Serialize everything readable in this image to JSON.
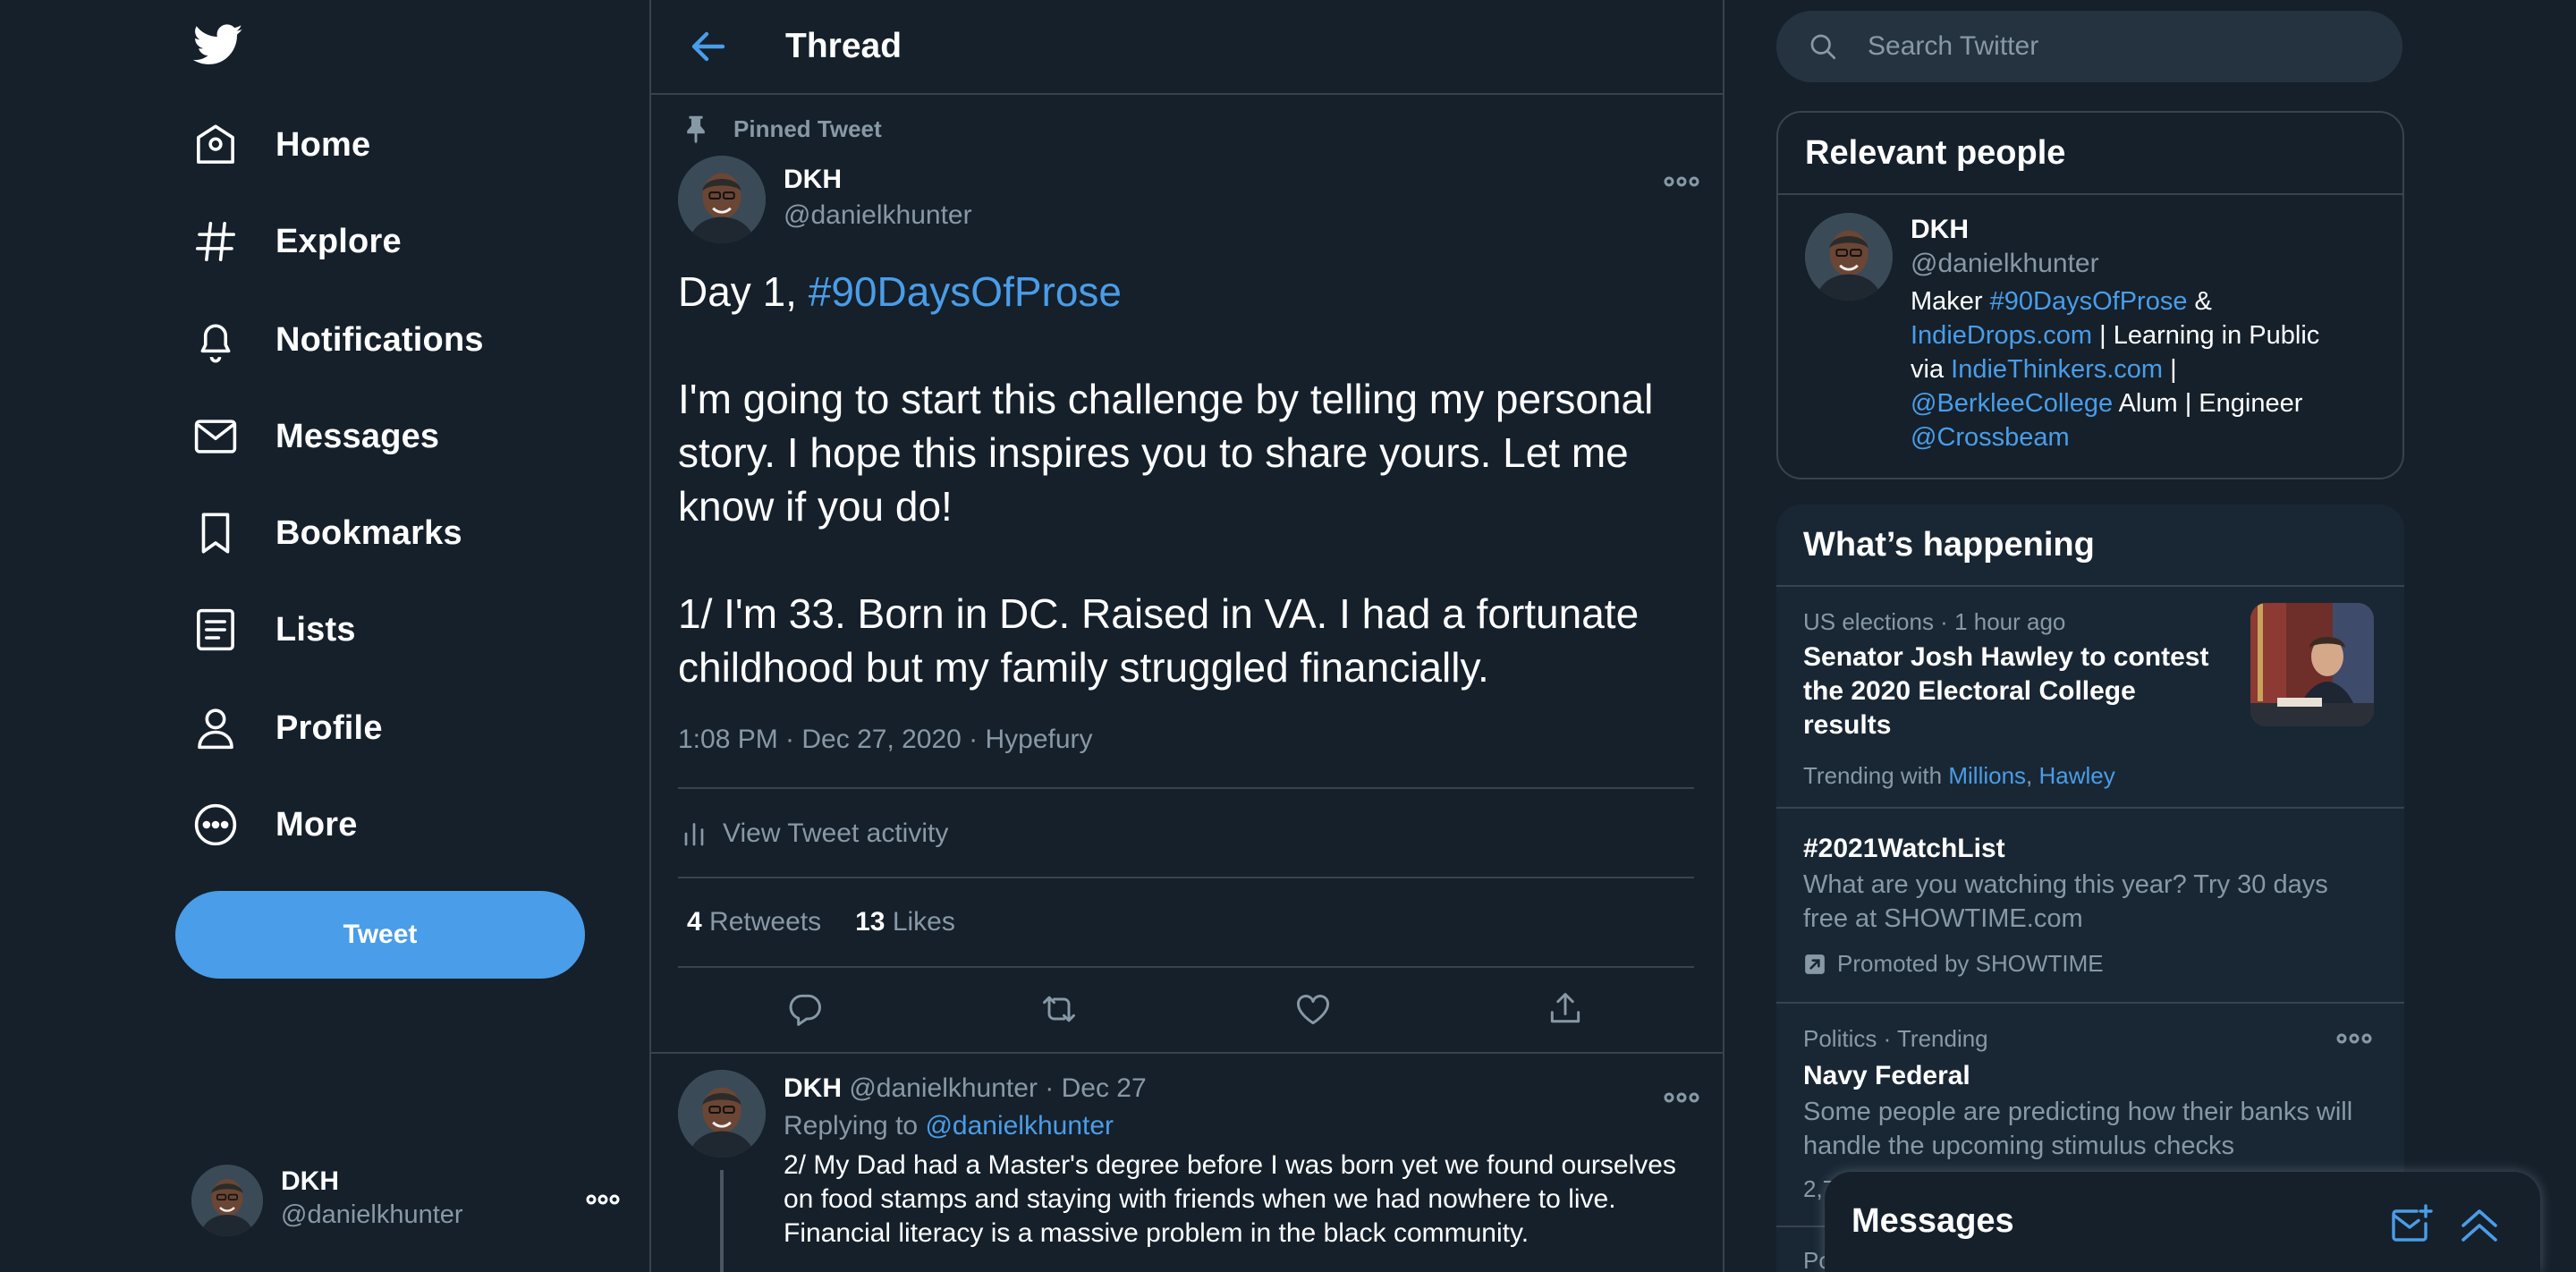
{
  "sidebar": {
    "nav": [
      {
        "label": "Home",
        "icon": "home-icon"
      },
      {
        "label": "Explore",
        "icon": "hashtag-icon"
      },
      {
        "label": "Notifications",
        "icon": "bell-icon"
      },
      {
        "label": "Messages",
        "icon": "mail-icon"
      },
      {
        "label": "Bookmarks",
        "icon": "bookmark-icon"
      },
      {
        "label": "Lists",
        "icon": "list-icon"
      },
      {
        "label": "Profile",
        "icon": "person-icon"
      },
      {
        "label": "More",
        "icon": "more-circle-icon"
      }
    ],
    "tweet_button": "Tweet",
    "account": {
      "name": "DKH",
      "handle": "@danielkhunter"
    }
  },
  "header": {
    "title": "Thread"
  },
  "main_tweet": {
    "pinned_label": "Pinned Tweet",
    "name": "DKH",
    "handle": "@danielkhunter",
    "text_line1_prefix": "Day 1, ",
    "text_line1_hashtag": "#90DaysOfProse",
    "para2": "I'm going to start this challenge by telling my personal story. I hope this inspires you to share yours. Let me know if you do!",
    "para3": "1/ I'm 33. Born in DC. Raised in VA. I had a fortunate childhood but my family struggled financially.",
    "meta": "1:08 PM · Dec 27, 2020 · Hypefury",
    "activity_label": "View Tweet activity",
    "retweets_count": "4",
    "retweets_label": "Retweets",
    "likes_count": "13",
    "likes_label": "Likes"
  },
  "reply_tweet": {
    "name": "DKH",
    "handle_date": "@danielkhunter · Dec 27",
    "replying_prefix": "Replying to ",
    "replying_handle": "@danielkhunter",
    "text": "2/ My Dad had a Master's degree before I was born yet we found ourselves on food stamps and staying with friends when we had nowhere to live. Financial literacy is a massive problem in the black community."
  },
  "search": {
    "placeholder": "Search Twitter"
  },
  "relevant_people": {
    "title": "Relevant people",
    "name": "DKH",
    "handle": "@danielkhunter",
    "bio": {
      "maker": "Maker ",
      "hashtag": "#90DaysOfProse",
      "amp": " &",
      "link1": "IndieDrops.com",
      "mid1": " | Learning in Public",
      "via": "via ",
      "link2": "IndieThinkers.com",
      "pipe": " |",
      "mention1": "@BerkleeCollege",
      "mid2": " Alum | Engineer",
      "mention2": "@Crossbeam"
    }
  },
  "whats_happening": {
    "title": "What’s happening",
    "trends": [
      {
        "meta": "US elections · 1 hour ago",
        "title": "Senator Josh Hawley to contest the 2020 Electoral College results",
        "trending_with": "Trending with",
        "tags": [
          "Millions",
          "Hawley"
        ]
      },
      {
        "title": "#2021WatchList",
        "desc": "What are you watching this year? Try 30 days free at SHOWTIME.com",
        "promoted": "Promoted by SHOWTIME"
      },
      {
        "meta": "Politics · Trending",
        "title": "Navy Federal",
        "desc": "Some people are predicting how their banks will handle the upcoming stimulus checks",
        "count_partial": "2,7",
        "next_partial": "Po"
      }
    ]
  },
  "messages_drawer": {
    "title": "Messages"
  },
  "colors": {
    "background": "#15202b",
    "accent": "#4a9de8",
    "muted": "#8899a6",
    "border": "#38444d"
  }
}
